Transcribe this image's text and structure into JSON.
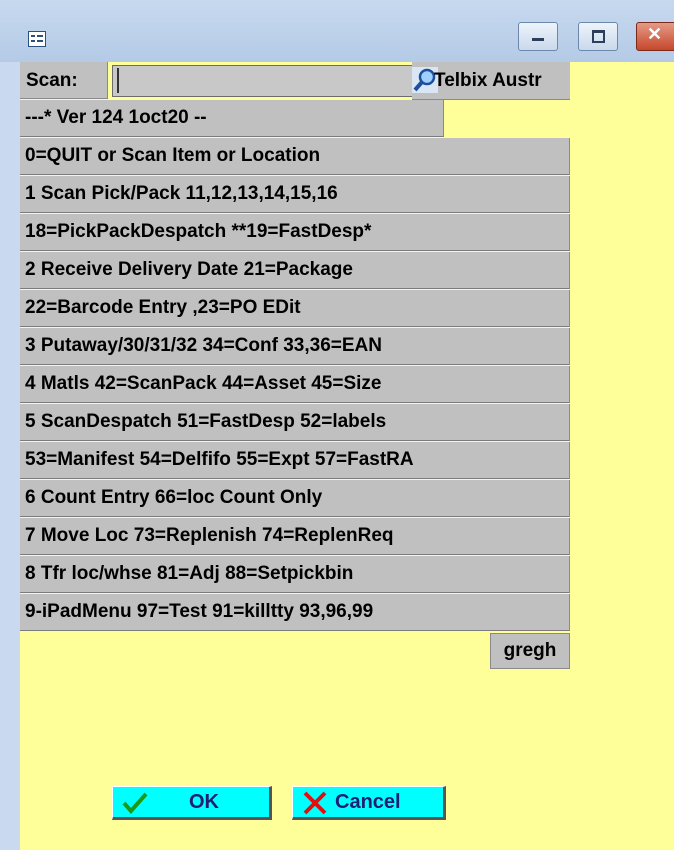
{
  "window": {
    "title": ""
  },
  "scan": {
    "label": "Scan:",
    "value": "",
    "company": "Telbix Austr"
  },
  "menu": [
    "---* Ver 124  1oct20 --",
    "0=QUIT or Scan Item or Location",
    "1 Scan Pick/Pack 11,12,13,14,15,16",
    "18=PickPackDespatch **19=FastDesp*",
    "2 Receive Delivery Date 21=Package",
    "22=Barcode Entry ,23=PO EDit",
    "3 Putaway/30/31/32 34=Conf 33,36=EAN",
    "4 Matls 42=ScanPack 44=Asset 45=Size",
    "5 ScanDespatch 51=FastDesp 52=labels",
    "53=Manifest 54=Delfifo 55=Expt 57=FastRA",
    "6 Count Entry 66=loc Count Only",
    "7 Move Loc 73=Replenish 74=ReplenReq",
    "8 Tfr loc/whse 81=Adj 88=Setpickbin",
    "9-iPadMenu 97=Test 91=killtty 93,96,99"
  ],
  "user": "gregh",
  "buttons": {
    "ok": "OK",
    "cancel": "Cancel"
  },
  "icons": {
    "app": "app-window-icon",
    "search": "magnifier-icon",
    "ok": "checkmark-icon",
    "cancel": "x-icon"
  },
  "colors": {
    "client_bg": "#ffff99",
    "row_bg": "#c0c0c0",
    "button_bg": "#00ffff",
    "title_bg": "#c7d9ef",
    "close_btn": "#c6472c"
  }
}
